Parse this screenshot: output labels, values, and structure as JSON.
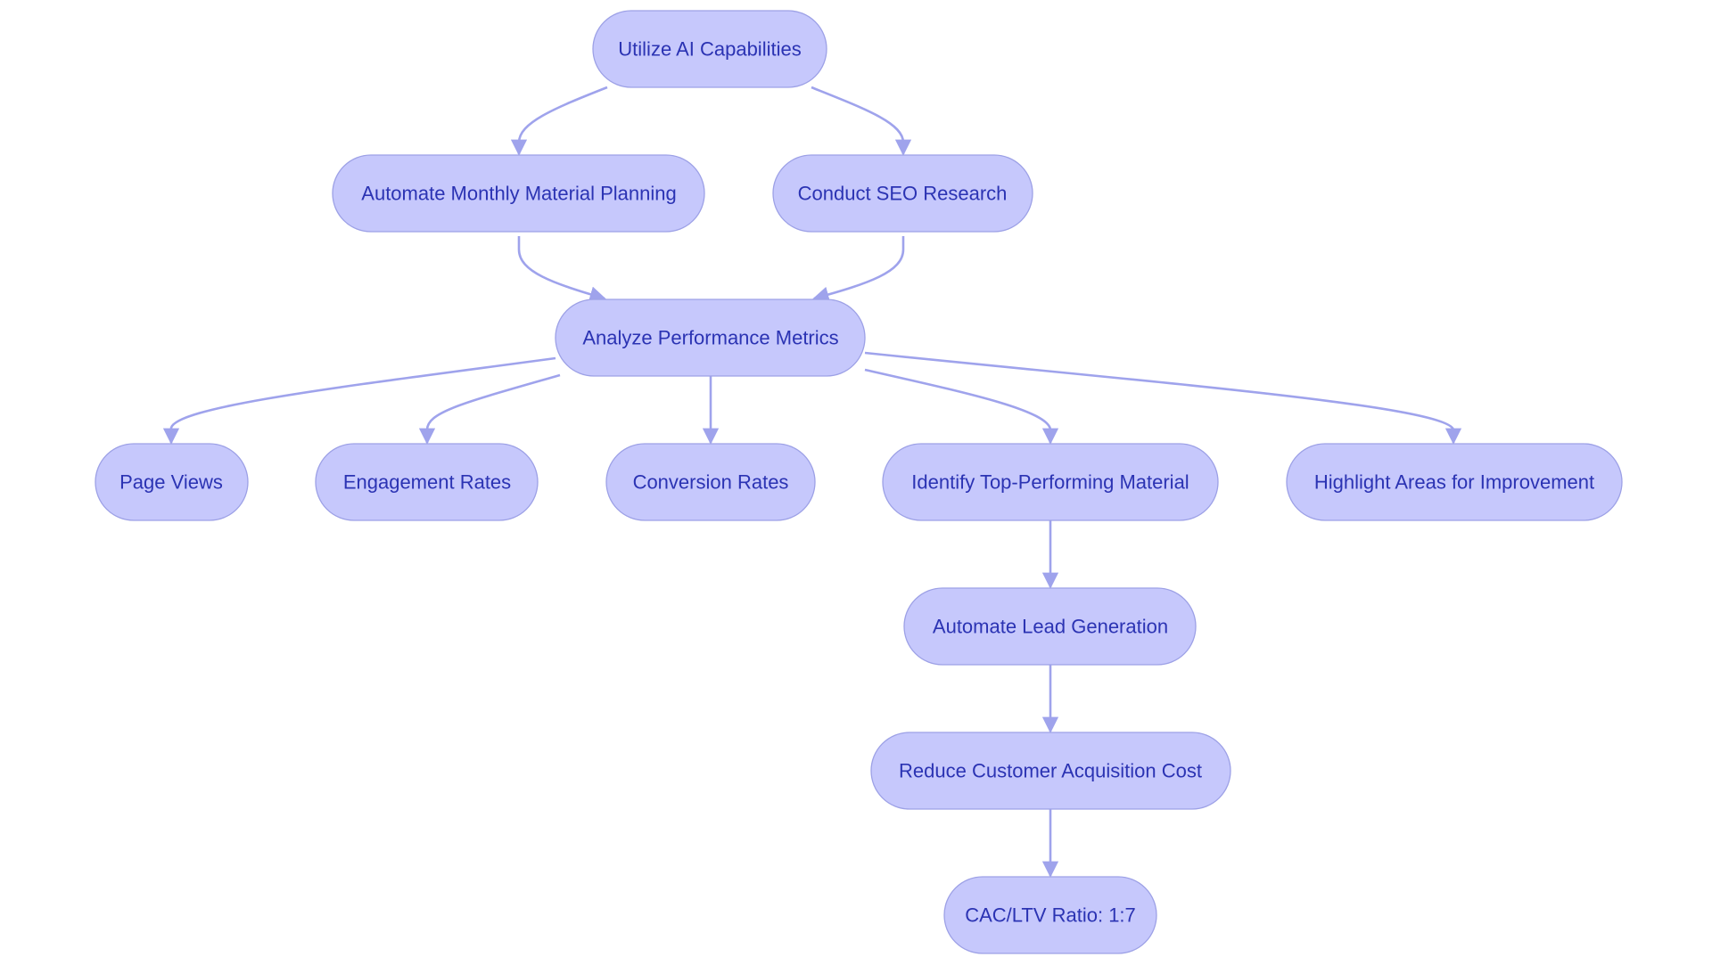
{
  "diagram": {
    "type": "flowchart",
    "direction": "top-down",
    "colors": {
      "node_fill": "#c6c8fc",
      "node_stroke": "#9da1e6",
      "text": "#2b33b3",
      "edge": "#9fa3ec",
      "background": "#ffffff"
    },
    "nodes": [
      {
        "id": "utilize-ai",
        "label": "Utilize AI Capabilities"
      },
      {
        "id": "automate-planning",
        "label": "Automate Monthly Material Planning"
      },
      {
        "id": "seo-research",
        "label": "Conduct SEO Research"
      },
      {
        "id": "analyze-metrics",
        "label": "Analyze Performance Metrics"
      },
      {
        "id": "page-views",
        "label": "Page Views"
      },
      {
        "id": "engagement-rates",
        "label": "Engagement Rates"
      },
      {
        "id": "conversion-rates",
        "label": "Conversion Rates"
      },
      {
        "id": "identify-top",
        "label": "Identify Top-Performing Material"
      },
      {
        "id": "highlight-areas",
        "label": "Highlight Areas for Improvement"
      },
      {
        "id": "automate-lead",
        "label": "Automate Lead Generation"
      },
      {
        "id": "reduce-cac",
        "label": "Reduce Customer Acquisition Cost"
      },
      {
        "id": "cac-ltv",
        "label": "CAC/LTV Ratio: 1:7"
      }
    ],
    "edges": [
      {
        "from": "utilize-ai",
        "to": "automate-planning"
      },
      {
        "from": "utilize-ai",
        "to": "seo-research"
      },
      {
        "from": "automate-planning",
        "to": "analyze-metrics"
      },
      {
        "from": "seo-research",
        "to": "analyze-metrics"
      },
      {
        "from": "analyze-metrics",
        "to": "page-views"
      },
      {
        "from": "analyze-metrics",
        "to": "engagement-rates"
      },
      {
        "from": "analyze-metrics",
        "to": "conversion-rates"
      },
      {
        "from": "analyze-metrics",
        "to": "identify-top"
      },
      {
        "from": "analyze-metrics",
        "to": "highlight-areas"
      },
      {
        "from": "identify-top",
        "to": "automate-lead"
      },
      {
        "from": "automate-lead",
        "to": "reduce-cac"
      },
      {
        "from": "reduce-cac",
        "to": "cac-ltv"
      }
    ]
  }
}
